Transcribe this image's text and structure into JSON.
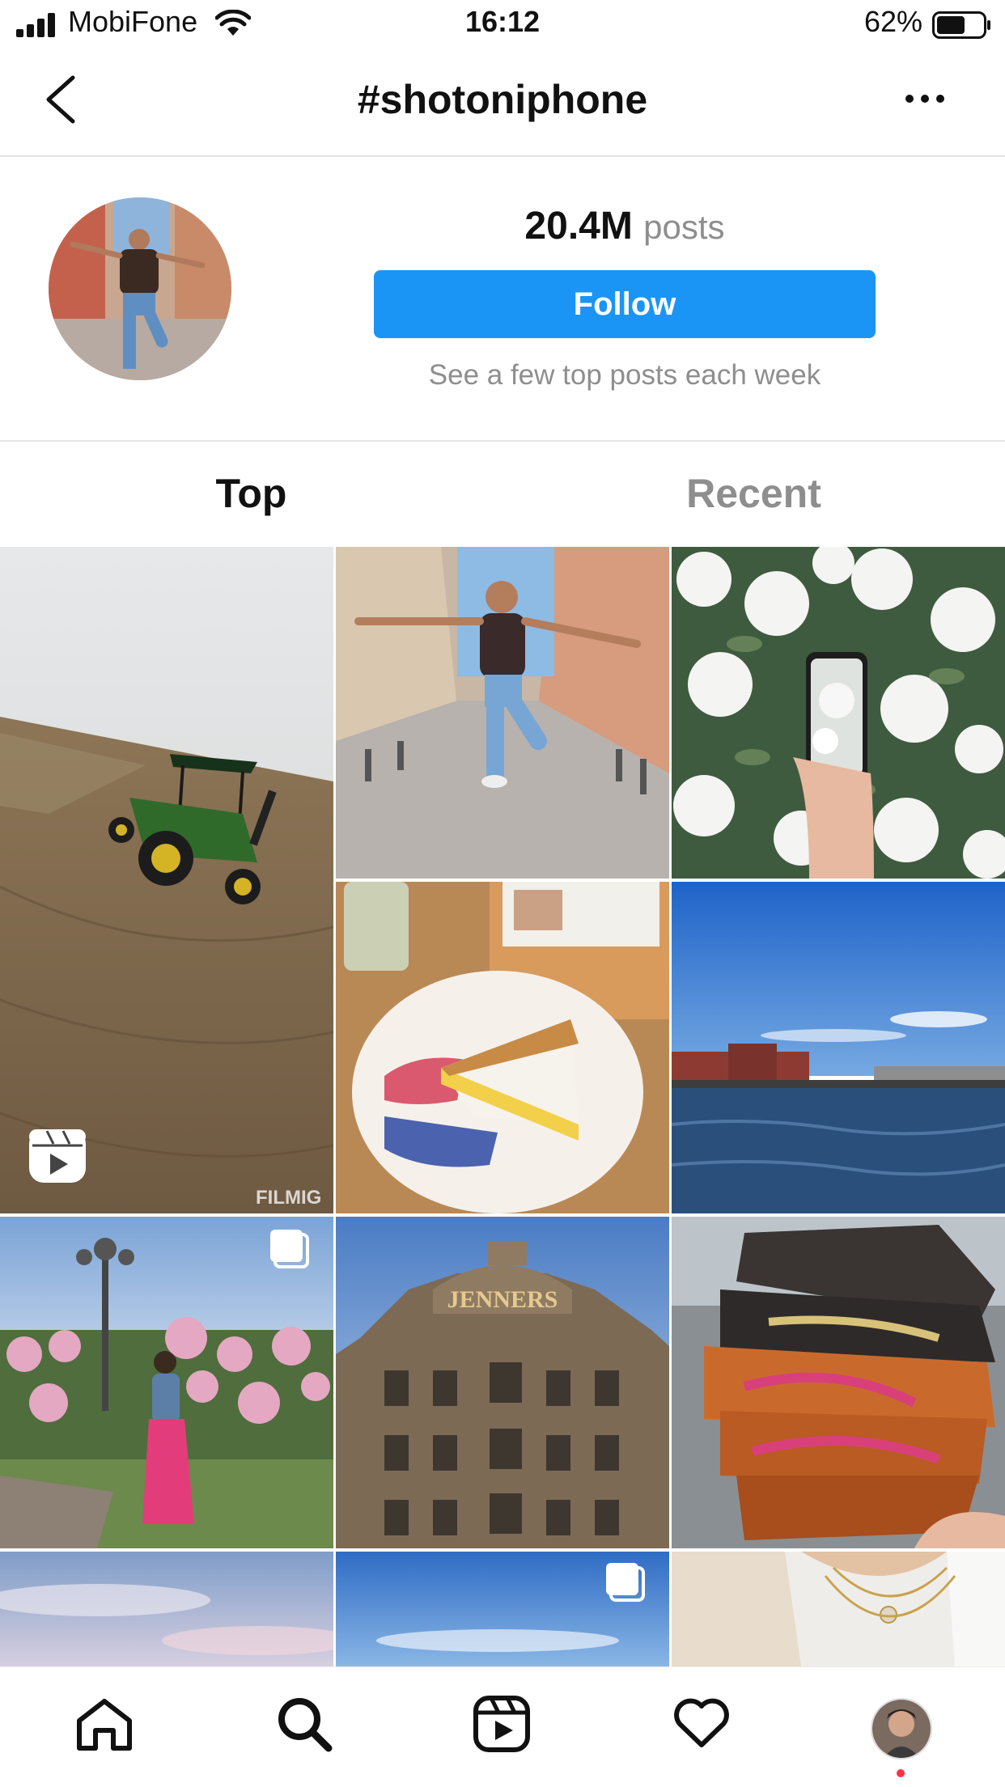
{
  "status_bar": {
    "carrier": "MobiFone",
    "time": "16:12",
    "battery_percent": "62%",
    "battery_level": 0.62,
    "signal_icon": "signal-bars-icon",
    "wifi_icon": "wifi-icon",
    "battery_icon": "battery-icon"
  },
  "nav": {
    "title": "#shotoniphone",
    "back_icon": "back-chevron-icon",
    "more_icon": "more-dots-icon"
  },
  "hashtag_header": {
    "post_count": "20.4M",
    "post_unit": "posts",
    "follow_label": "Follow",
    "subtitle": "See a few top posts each week",
    "accent_color": "#1a95f5"
  },
  "tabs": [
    {
      "label": "Top",
      "active": true
    },
    {
      "label": "Recent",
      "active": false
    }
  ],
  "grid": {
    "posts": [
      {
        "subject": "tractor in field",
        "badge": "reels-icon",
        "watermark": "FILMIG"
      },
      {
        "subject": "man dancing in street",
        "badge": null
      },
      {
        "subject": "white flowers with phone",
        "badge": null
      },
      {
        "subject": "lemon meringue pie",
        "badge": null
      },
      {
        "subject": "harbour with blue sky",
        "badge": null
      },
      {
        "subject": "woman in pink skirt among roses",
        "badge": "carousel-icon"
      },
      {
        "subject": "Jenners building",
        "badge": null,
        "sign_text": "JENNERS"
      },
      {
        "subject": "stacked tacos",
        "badge": null
      },
      {
        "subject": "cloudy sky",
        "badge": null
      },
      {
        "subject": "blue sky",
        "badge": "carousel-icon"
      },
      {
        "subject": "woman with necklace",
        "badge": null
      }
    ]
  },
  "bottom_nav": [
    {
      "icon": "home-icon"
    },
    {
      "icon": "search-icon",
      "active": true
    },
    {
      "icon": "reels-icon"
    },
    {
      "icon": "heart-icon"
    },
    {
      "icon": "profile-avatar",
      "notification_dot": true
    }
  ]
}
